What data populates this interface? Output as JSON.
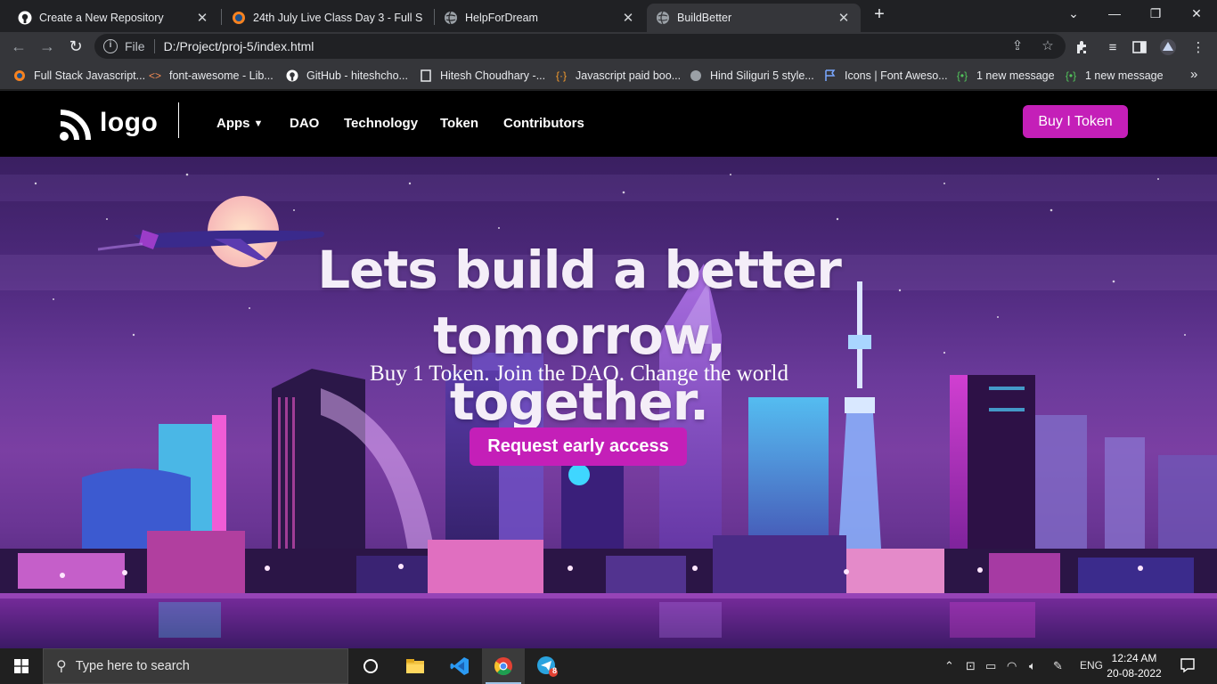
{
  "browser": {
    "tabs": [
      {
        "title": "Create a New Repository",
        "icon": "github-icon"
      },
      {
        "title": "24th July Live Class Day 3 - Full S",
        "icon": "course-icon"
      },
      {
        "title": "HelpForDream",
        "icon": "globe-icon"
      },
      {
        "title": "BuildBetter",
        "icon": "globe-icon",
        "active": true
      }
    ],
    "address": {
      "scheme": "File",
      "url": "D:/Project/proj-5/index.html"
    },
    "bookmarks": [
      {
        "label": "Full Stack Javascript...",
        "icon": "orange-circle-icon"
      },
      {
        "label": "font-awesome - Lib...",
        "icon": "code-brackets-icon"
      },
      {
        "label": "GitHub - hiteshcho...",
        "icon": "github-icon"
      },
      {
        "label": "Hitesh Choudhary -...",
        "icon": "page-icon"
      },
      {
        "label": "Javascript paid boo...",
        "icon": "curly-braces-icon"
      },
      {
        "label": "Hind Siliguri 5 style...",
        "icon": "globe-icon"
      },
      {
        "label": "Icons | Font Aweso...",
        "icon": "flag-icon"
      },
      {
        "label": "1 new message",
        "icon": "message-icon"
      },
      {
        "label": "1 new message",
        "icon": "message-icon"
      }
    ]
  },
  "site": {
    "logo_text": "logo",
    "nav": {
      "apps": "Apps",
      "dao": "DAO",
      "technology": "Technology",
      "token": "Token",
      "contributors": "Contributors"
    },
    "buy_button": "Buy I Token",
    "hero": {
      "title_line1": "Lets build a better",
      "title_line2": "tomorrow, together.",
      "subtitle": "Buy 1 Token. Join the DAO. Change the world",
      "cta": "Request early access"
    },
    "colors": {
      "accent": "#c41fb8",
      "nav_bg": "#000000"
    }
  },
  "taskbar": {
    "search_placeholder": "Type here to search",
    "language": "ENG",
    "time": "12:24 AM",
    "date": "20-08-2022",
    "telegram_badge": "8"
  }
}
